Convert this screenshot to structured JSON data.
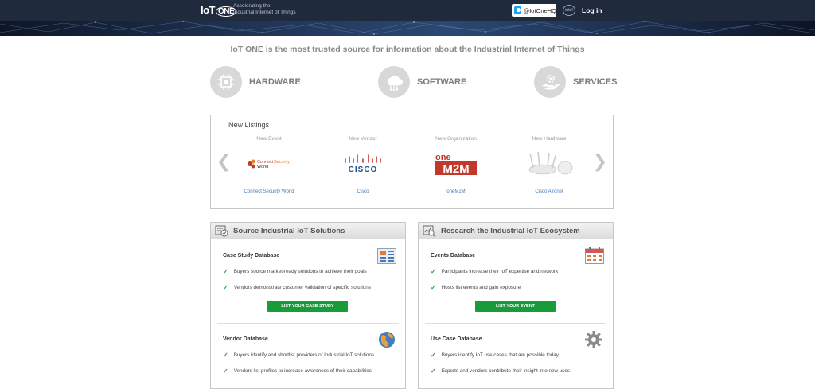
{
  "header": {
    "logo_text": "IoT",
    "logo_one": "ONE",
    "tagline_1": "Accelerating the",
    "tagline_2": "Industrial Internet of Things",
    "twitter_handle": "@IotOneHQ",
    "badge": "intel",
    "login_label": "Log in"
  },
  "headline": "IoT ONE is the most trusted source for information about the Industrial Internet of Things",
  "categories": [
    {
      "label": "HARDWARE",
      "icon": "chip-icon"
    },
    {
      "label": "SOFTWARE",
      "icon": "cloud-icon"
    },
    {
      "label": "SERVICES",
      "icon": "hand-gear-icon"
    }
  ],
  "listings": {
    "title": "New Listings",
    "items": [
      {
        "type": "New Event",
        "name": "Connect Security World",
        "logo_text": "Connect Security World"
      },
      {
        "type": "New Vendor",
        "name": "Cisco",
        "logo_text": "CISCO"
      },
      {
        "type": "New Organization",
        "name": "oneM2M",
        "logo_text": "oneM2M"
      },
      {
        "type": "New Hardware",
        "name": "Cisco Aironet",
        "logo_text": ""
      }
    ]
  },
  "panels": {
    "left": {
      "title": "Source Industrial IoT Solutions",
      "sections": [
        {
          "title": "Case Study Database",
          "bullets": [
            "Buyers source market-ready solutions to achieve their goals",
            "Vendors demonstrate customer validation of specific solutions"
          ],
          "cta": "LIST YOUR CASE STUDY"
        },
        {
          "title": "Vendor Database",
          "bullets": [
            "Buyers identify and shortlist providers of Industrial IoT solutions",
            "Vendors list profiles to increase awareness of their capabilities"
          ]
        }
      ]
    },
    "right": {
      "title": "Research the Industrial IoT Ecosystem",
      "sections": [
        {
          "title": "Events Database",
          "bullets": [
            "Participants increase their IoT expertise and network",
            "Hosts list events and gain exposure"
          ],
          "cta": "LIST YOUR EVENT"
        },
        {
          "title": "Use Case Database",
          "bullets": [
            "Buyers identify IoT use cases that are possible today",
            "Experts and vendors contribute their insight into new uses"
          ]
        }
      ]
    }
  },
  "colors": {
    "topbar": "#1f2a3d",
    "cta": "#1a9b3a",
    "link": "#3f7bbf",
    "check": "#2e9e3e"
  }
}
